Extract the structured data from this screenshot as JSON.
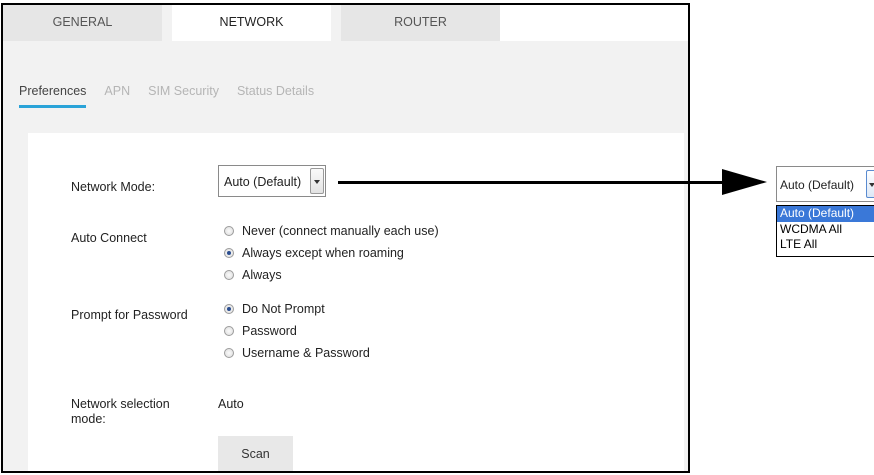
{
  "tabs": [
    "GENERAL",
    "NETWORK",
    "ROUTER"
  ],
  "active_tab": "NETWORK",
  "subtabs": [
    "Preferences",
    "APN",
    "SIM Security",
    "Status Details"
  ],
  "active_subtab": "Preferences",
  "form": {
    "network_mode": {
      "label": "Network Mode:",
      "value": "Auto (Default)"
    },
    "auto_connect": {
      "label": "Auto Connect",
      "options": [
        "Never (connect manually each use)",
        "Always except when roaming",
        "Always"
      ],
      "selected": "Always except when roaming"
    },
    "prompt_password": {
      "label": "Prompt for Password",
      "options": [
        "Do Not Prompt",
        "Password",
        "Username & Password"
      ],
      "selected": "Do Not Prompt"
    },
    "selection_mode": {
      "label_line1": "Network selection",
      "label_line2": "mode:",
      "value": "Auto"
    },
    "scan_label": "Scan"
  },
  "dropdown_callout": {
    "value": "Auto (Default)",
    "options": [
      "Auto (Default)",
      "WCDMA All",
      "LTE All"
    ],
    "highlighted": "Auto (Default)"
  },
  "colors": {
    "accent": "#2aa3d8",
    "highlight": "#3a78d8",
    "panel_bg": "#f2f2f2"
  }
}
